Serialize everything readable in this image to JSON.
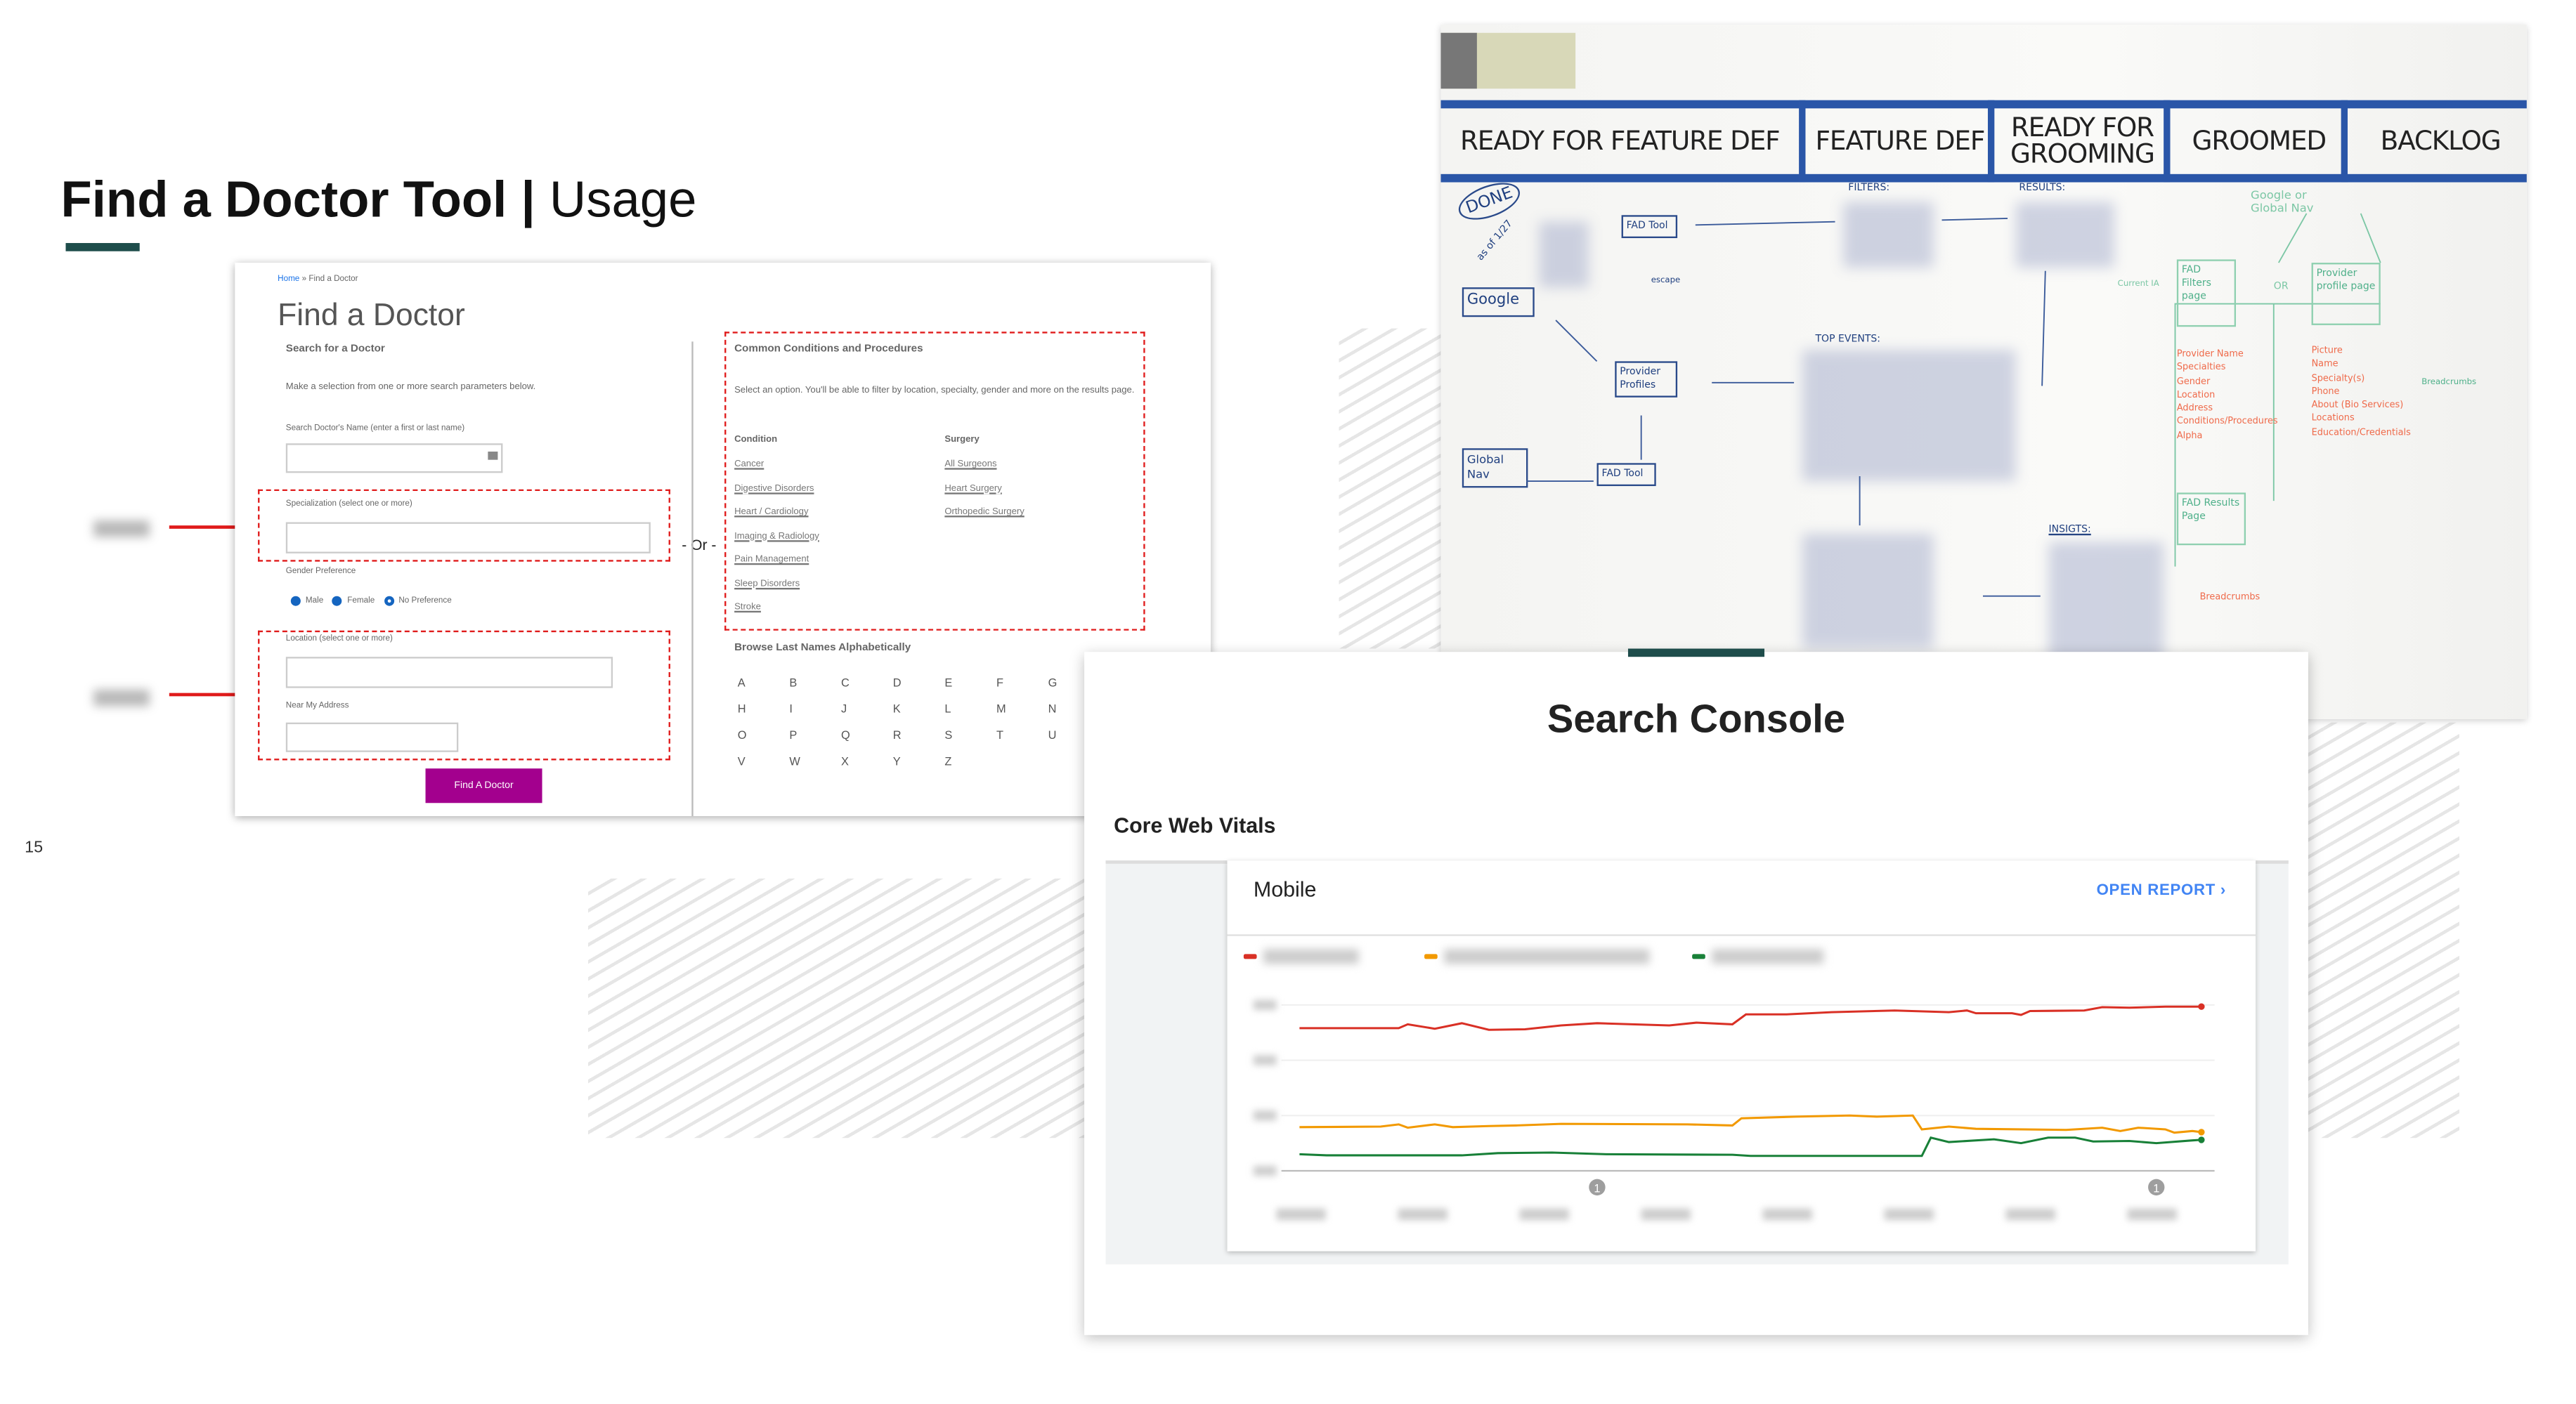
{
  "slide": {
    "title_bold": "Find a Doctor Tool",
    "title_sep": " | ",
    "title_light": "Usage",
    "page_number": "15",
    "accent_color": "#1e4d4b"
  },
  "find_a_doctor": {
    "breadcrumb": [
      "Home",
      "»",
      "Find a Doctor"
    ],
    "title": "Find a Doctor",
    "search_heading": "Search for a Doctor",
    "instructions": "Make a selection from one or more search parameters below.",
    "name_label": "Search Doctor's Name (enter a first or last name)",
    "specialization_label": "Specialization (select one or more)",
    "or_label": "- Or -",
    "gender_label": "Gender Preference",
    "gender_options": [
      {
        "label": "Male",
        "selected": false
      },
      {
        "label": "Female",
        "selected": false
      },
      {
        "label": "No Preference",
        "selected": true
      }
    ],
    "location_label": "Location (select one or more)",
    "near_label": "Near My Address",
    "button_label": "Find A Doctor",
    "button_color": "#a3008e",
    "conditions_heading": "Common Conditions and Procedures",
    "conditions_text": "Select an option. You'll be able to filter by location, specialty, gender and more on the results page.",
    "condition_heading": "Condition",
    "conditions": [
      "Cancer",
      "Digestive Disorders",
      "Heart / Cardiology",
      "Imaging & Radiology",
      "Pain Management",
      "Sleep Disorders",
      "Stroke"
    ],
    "surgery_heading": "Surgery",
    "surgeries": [
      "All Surgeons",
      "Heart Surgery",
      "Orthopedic Surgery"
    ],
    "browse_heading": "Browse Last Names Alphabetically",
    "letters": [
      "A",
      "B",
      "C",
      "D",
      "E",
      "F",
      "G",
      "H",
      "I",
      "J",
      "K",
      "L",
      "M",
      "N",
      "O",
      "P",
      "Q",
      "R",
      "S",
      "T",
      "U",
      "V",
      "W",
      "X",
      "Y",
      "Z"
    ],
    "highlight_color": "#e01b1b"
  },
  "whiteboard": {
    "columns": [
      "READY FOR FEATURE DEF",
      "FEATURE DEF",
      "READY FOR GROOMING",
      "GROOMED",
      "BACKLOG"
    ],
    "done_label": "DONE",
    "done_date": "as of 1/27",
    "boxes": [
      "FAD Tool",
      "Google",
      "Provider Profiles",
      "Global Nav",
      "FAD Tool"
    ],
    "escape_label": "escape",
    "section_labels": [
      "FILTERS:",
      "RESULTS:",
      "TOP EVENTS:",
      "INSIGTS:"
    ],
    "green_source": "Google or Global Nav",
    "green_boxes": [
      "FAD Filters page",
      "Provider profile page",
      "FAD Results Page"
    ],
    "current_ia": "Current IA",
    "or_label": "OR",
    "filters_fields": [
      "Provider Name",
      "Specialties",
      "Gender",
      "Location",
      "Address",
      "Conditions/Procedures",
      "Alpha"
    ],
    "profile_fields": [
      "Picture",
      "Name",
      "Specialty(s)",
      "Phone",
      "About (Bio Services)",
      "Locations",
      "Education/Credentials"
    ],
    "breadcrumbs_label": "Breadcrumbs"
  },
  "search_console": {
    "title": "Search Console",
    "subtitle": "Core Web Vitals",
    "card_title": "Mobile",
    "open_report": "OPEN REPORT",
    "annotation_markers": [
      "1",
      "1"
    ]
  },
  "chart_data": {
    "type": "line",
    "title": "",
    "xlabel": "",
    "ylabel": "",
    "note_labels_blurred": true,
    "ylim": [
      0,
      3
    ],
    "xlim": [
      0,
      100
    ],
    "grid": true,
    "legend": "top-left",
    "series": [
      {
        "color": "#d93025",
        "points": [
          [
            0,
            2.58
          ],
          [
            11,
            2.58
          ],
          [
            12,
            2.65
          ],
          [
            15,
            2.57
          ],
          [
            18,
            2.67
          ],
          [
            21,
            2.55
          ],
          [
            25,
            2.56
          ],
          [
            29,
            2.63
          ],
          [
            33,
            2.67
          ],
          [
            41,
            2.63
          ],
          [
            44,
            2.68
          ],
          [
            48,
            2.65
          ],
          [
            49.5,
            2.83
          ],
          [
            54,
            2.83
          ],
          [
            59,
            2.87
          ],
          [
            66,
            2.9
          ],
          [
            72,
            2.87
          ],
          [
            74,
            2.9
          ],
          [
            75,
            2.85
          ],
          [
            79,
            2.85
          ],
          [
            80,
            2.82
          ],
          [
            81,
            2.89
          ],
          [
            87,
            2.9
          ],
          [
            89,
            2.96
          ],
          [
            92,
            2.95
          ],
          [
            96,
            2.97
          ],
          [
            100,
            2.97
          ]
        ]
      },
      {
        "color": "#f29900",
        "points": [
          [
            0,
            0.79
          ],
          [
            9,
            0.8
          ],
          [
            11,
            0.84
          ],
          [
            12,
            0.78
          ],
          [
            15,
            0.84
          ],
          [
            17,
            0.79
          ],
          [
            21,
            0.81
          ],
          [
            24,
            0.82
          ],
          [
            29,
            0.85
          ],
          [
            43,
            0.84
          ],
          [
            48,
            0.82
          ],
          [
            49,
            0.95
          ],
          [
            55,
            0.98
          ],
          [
            61,
            1.0
          ],
          [
            64,
            0.98
          ],
          [
            68,
            1.0
          ],
          [
            69,
            0.75
          ],
          [
            72,
            0.8
          ],
          [
            75,
            0.76
          ],
          [
            85,
            0.74
          ],
          [
            89,
            0.78
          ],
          [
            91,
            0.72
          ],
          [
            93,
            0.78
          ],
          [
            96,
            0.75
          ],
          [
            97,
            0.69
          ],
          [
            99,
            0.72
          ],
          [
            100,
            0.7
          ]
        ]
      },
      {
        "color": "#188038",
        "points": [
          [
            0,
            0.3
          ],
          [
            3,
            0.28
          ],
          [
            18,
            0.28
          ],
          [
            22,
            0.32
          ],
          [
            28,
            0.33
          ],
          [
            34,
            0.3
          ],
          [
            48,
            0.29
          ],
          [
            50,
            0.27
          ],
          [
            69,
            0.27
          ],
          [
            70,
            0.6
          ],
          [
            72,
            0.52
          ],
          [
            77,
            0.57
          ],
          [
            80,
            0.5
          ],
          [
            83,
            0.6
          ],
          [
            86,
            0.6
          ],
          [
            88,
            0.53
          ],
          [
            92,
            0.54
          ],
          [
            95,
            0.5
          ],
          [
            99,
            0.55
          ],
          [
            100,
            0.56
          ]
        ]
      }
    ],
    "annotations_x": [
      33,
      95
    ]
  }
}
